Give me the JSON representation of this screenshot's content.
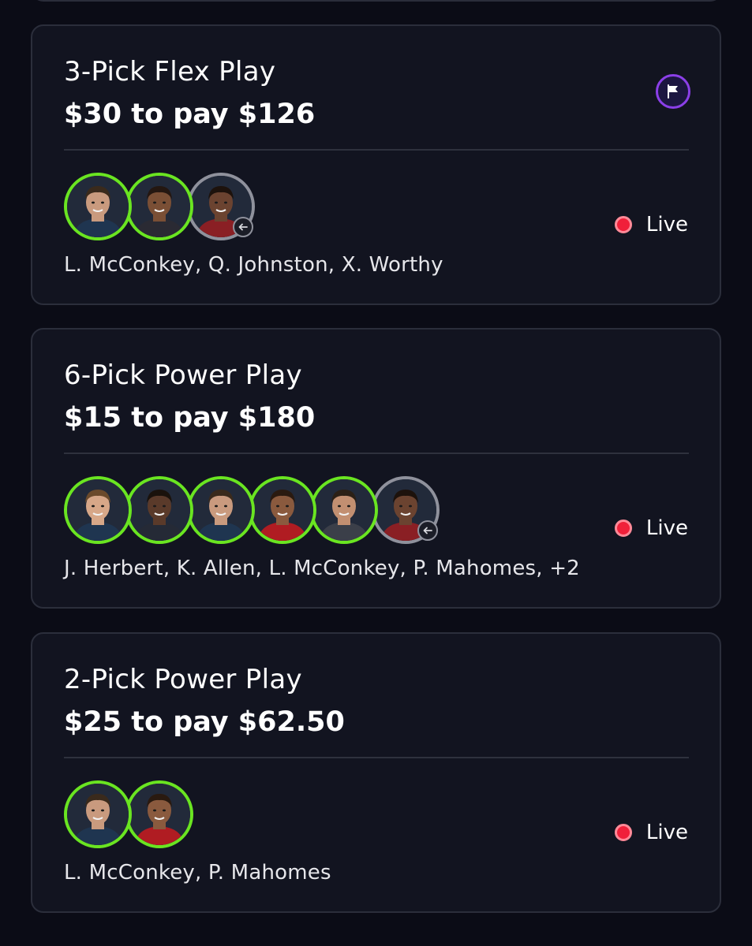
{
  "cards": [
    {
      "title": "3-Pick Flex Play",
      "subtitle": "$30 to pay $126",
      "has_flag": true,
      "picks": [
        {
          "name": "L. McConkey",
          "state": "active",
          "skin": "#c99a7e",
          "hair": "#3a2a1c",
          "jersey": "#1f3550"
        },
        {
          "name": "Q. Johnston",
          "state": "active",
          "skin": "#7a4f35",
          "hair": "#241711",
          "jersey": "#2a2a33"
        },
        {
          "name": "X. Worthy",
          "state": "swapped",
          "skin": "#6b4330",
          "hair": "#1d120c",
          "jersey": "#8a1f24"
        }
      ],
      "names": "L. McConkey, Q. Johnston, X. Worthy",
      "status": "Live"
    },
    {
      "title": "6-Pick Power Play",
      "subtitle": "$15 to pay $180",
      "has_flag": false,
      "picks": [
        {
          "name": "J. Herbert",
          "state": "active",
          "skin": "#d7a788",
          "hair": "#6b4a2b",
          "jersey": "#1f3550"
        },
        {
          "name": "K. Allen",
          "state": "active",
          "skin": "#5a3a2a",
          "hair": "#1a120c",
          "jersey": "#252a36"
        },
        {
          "name": "L. McConkey",
          "state": "active",
          "skin": "#c99a7e",
          "hair": "#3a2a1c",
          "jersey": "#1f3550"
        },
        {
          "name": "P. Mahomes",
          "state": "active",
          "skin": "#8a5a3e",
          "hair": "#2a1a10",
          "jersey": "#b01c22"
        },
        {
          "name": "",
          "state": "active",
          "skin": "#c28f71",
          "hair": "#2c2016",
          "jersey": "#3b3f49"
        },
        {
          "name": "",
          "state": "swapped",
          "skin": "#6b4330",
          "hair": "#1d120c",
          "jersey": "#8a1f24"
        }
      ],
      "names": "J. Herbert, K. Allen, L. McConkey, P. Mahomes, +2",
      "status": "Live"
    },
    {
      "title": "2-Pick Power Play",
      "subtitle": "$25 to pay $62.50",
      "has_flag": false,
      "picks": [
        {
          "name": "L. McConkey",
          "state": "active",
          "skin": "#c99a7e",
          "hair": "#3a2a1c",
          "jersey": "#1f3550"
        },
        {
          "name": "P. Mahomes",
          "state": "active",
          "skin": "#8a5a3e",
          "hair": "#2a1a10",
          "jersey": "#b01c22"
        }
      ],
      "names": "L. McConkey, P. Mahomes",
      "status": "Live"
    }
  ],
  "colors": {
    "background": "#0b0c16",
    "card": "#121420",
    "card_border": "#2b2e3b",
    "active_ring": "#6ae521",
    "swapped_ring": "#8f919c",
    "live": "#f0203a",
    "flag_ring": "#8b3fe8"
  }
}
